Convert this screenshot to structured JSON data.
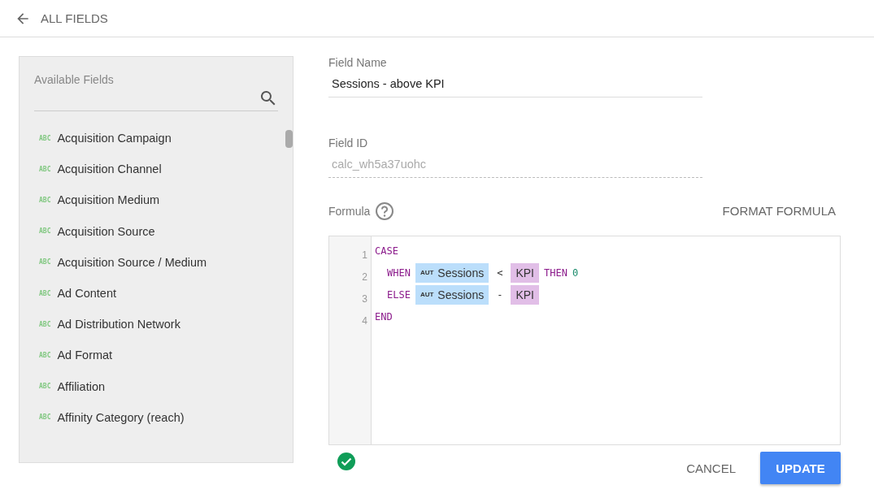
{
  "header": {
    "title": "ALL FIELDS"
  },
  "fields_panel": {
    "title": "Available Fields",
    "items": [
      {
        "type_badge": "ABC",
        "name": "Acquisition Campaign"
      },
      {
        "type_badge": "ABC",
        "name": "Acquisition Channel"
      },
      {
        "type_badge": "ABC",
        "name": "Acquisition Medium"
      },
      {
        "type_badge": "ABC",
        "name": "Acquisition Source"
      },
      {
        "type_badge": "ABC",
        "name": "Acquisition Source / Medium"
      },
      {
        "type_badge": "ABC",
        "name": "Ad Content"
      },
      {
        "type_badge": "ABC",
        "name": "Ad Distribution Network"
      },
      {
        "type_badge": "ABC",
        "name": "Ad Format"
      },
      {
        "type_badge": "ABC",
        "name": "Affiliation"
      },
      {
        "type_badge": "ABC",
        "name": "Affinity Category (reach)"
      }
    ]
  },
  "field_name": {
    "label": "Field Name",
    "value": "Sessions - above KPI"
  },
  "field_id": {
    "label": "Field ID",
    "value": "calc_wh5a37uohc",
    "disabled": true
  },
  "formula": {
    "label": "Formula",
    "format_button": "FORMAT FORMULA",
    "valid": true,
    "lines": [
      {
        "number": "1",
        "indented": false,
        "tokens": [
          {
            "kind": "keyword",
            "text": "CASE"
          }
        ]
      },
      {
        "number": "2",
        "indented": true,
        "tokens": [
          {
            "kind": "keyword",
            "text": "WHEN"
          },
          {
            "kind": "field",
            "badge": "AUT",
            "text": "Sessions"
          },
          {
            "kind": "op",
            "text": "<"
          },
          {
            "kind": "param",
            "text": "KPI"
          },
          {
            "kind": "keyword",
            "text": "THEN"
          },
          {
            "kind": "number",
            "text": "0"
          }
        ]
      },
      {
        "number": "3",
        "indented": true,
        "tokens": [
          {
            "kind": "keyword",
            "text": "ELSE"
          },
          {
            "kind": "field",
            "badge": "AUT",
            "text": "Sessions"
          },
          {
            "kind": "op",
            "text": "-"
          },
          {
            "kind": "param",
            "text": "KPI"
          }
        ]
      },
      {
        "number": "4",
        "indented": false,
        "tokens": [
          {
            "kind": "keyword",
            "text": "END"
          }
        ]
      }
    ]
  },
  "buttons": {
    "cancel": "CANCEL",
    "update": "UPDATE"
  }
}
